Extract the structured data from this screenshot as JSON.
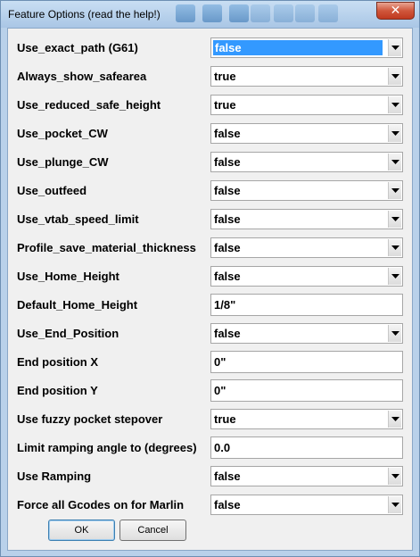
{
  "window": {
    "title": "Feature Options (read the help!)",
    "close_glyph": "✕"
  },
  "options": [
    {
      "label": "Use_exact_path (G61)",
      "type": "combo",
      "value": "false",
      "focused": true
    },
    {
      "label": "Always_show_safearea",
      "type": "combo",
      "value": "true"
    },
    {
      "label": "Use_reduced_safe_height",
      "type": "combo",
      "value": "true"
    },
    {
      "label": "Use_pocket_CW",
      "type": "combo",
      "value": "false"
    },
    {
      "label": "Use_plunge_CW",
      "type": "combo",
      "value": "false"
    },
    {
      "label": "Use_outfeed",
      "type": "combo",
      "value": "false"
    },
    {
      "label": "Use_vtab_speed_limit",
      "type": "combo",
      "value": "false"
    },
    {
      "label": "Profile_save_material_thickness",
      "type": "combo",
      "value": "false"
    },
    {
      "label": "Use_Home_Height",
      "type": "combo",
      "value": "false"
    },
    {
      "label": "Default_Home_Height",
      "type": "text",
      "value": "1/8\""
    },
    {
      "label": "Use_End_Position",
      "type": "combo",
      "value": "false"
    },
    {
      "label": "End position X",
      "type": "text",
      "value": "0\""
    },
    {
      "label": "End position Y",
      "type": "text",
      "value": "0\""
    },
    {
      "label": "Use fuzzy pocket stepover",
      "type": "combo",
      "value": "true"
    },
    {
      "label": "Limit ramping angle to (degrees)",
      "type": "text",
      "value": "0.0"
    },
    {
      "label": "Use Ramping",
      "type": "combo",
      "value": "false"
    },
    {
      "label": "Force all Gcodes on for Marlin",
      "type": "combo",
      "value": "false"
    }
  ],
  "buttons": {
    "ok": "OK",
    "cancel": "Cancel"
  },
  "colors": {
    "selection": "#3399ff",
    "frame": "#b9d1ea",
    "close": "#c0391f"
  }
}
